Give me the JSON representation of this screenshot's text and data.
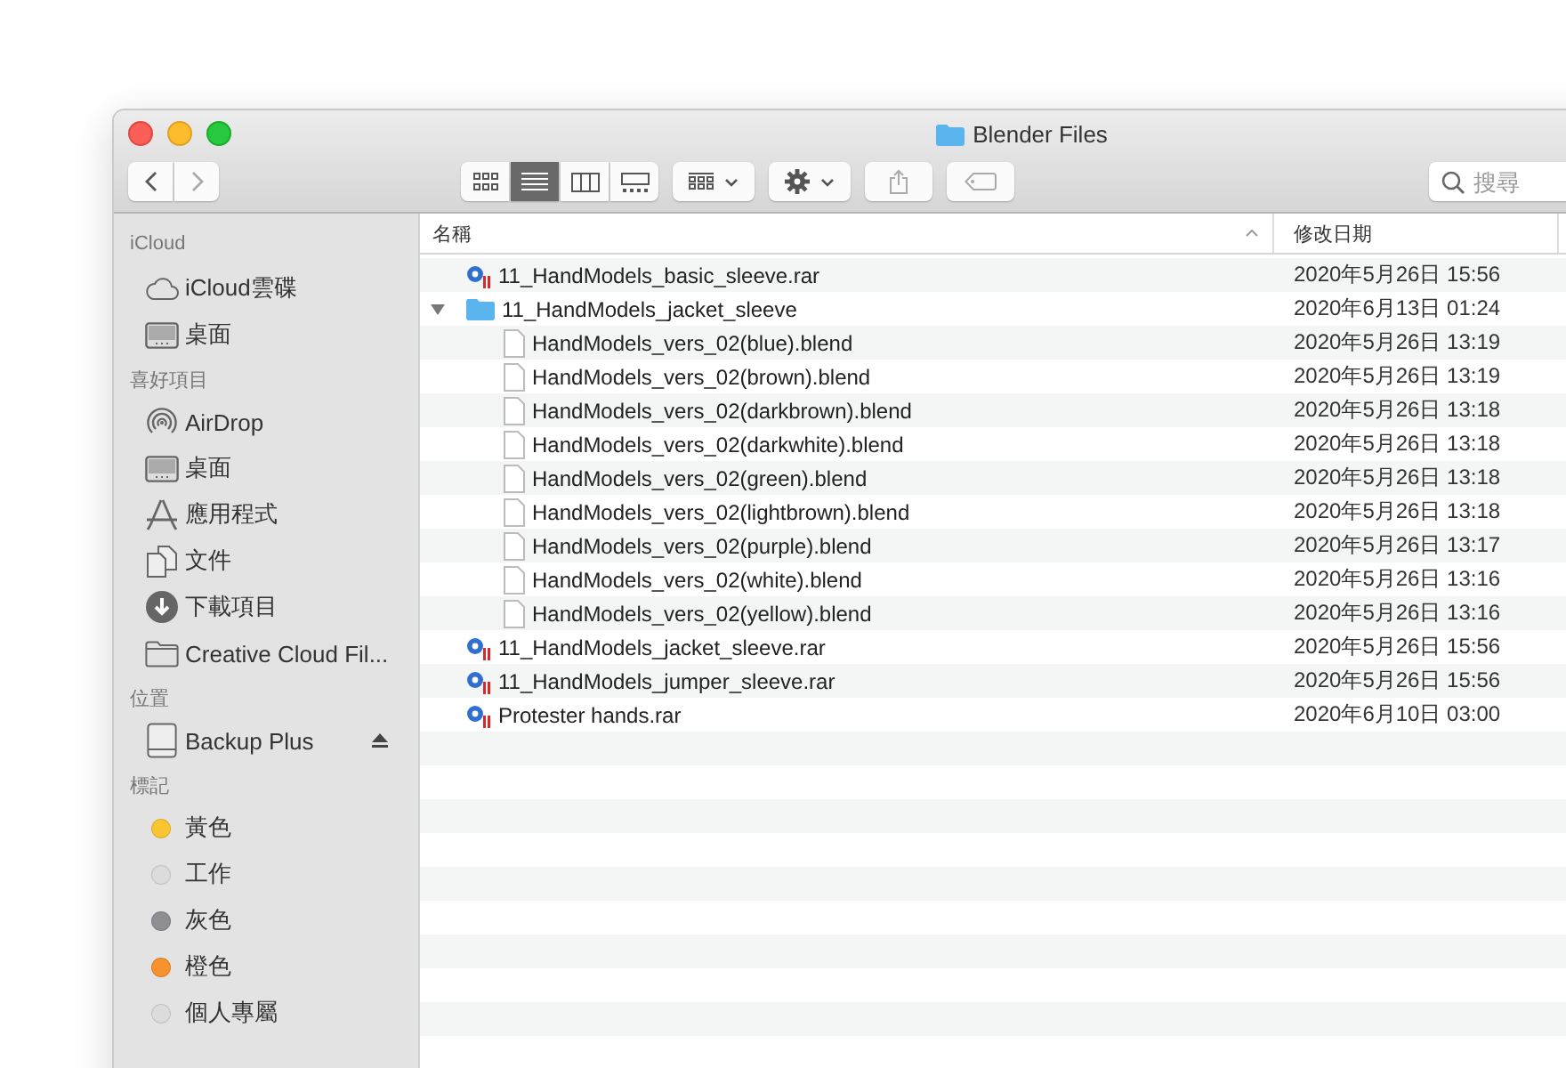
{
  "window": {
    "title": "Blender Files"
  },
  "toolbar": {
    "view_buttons": [
      {
        "kind": "icons",
        "selected": false
      },
      {
        "kind": "list",
        "selected": true
      },
      {
        "kind": "columns",
        "selected": false
      },
      {
        "kind": "gallery",
        "selected": false
      }
    ],
    "search": {
      "placeholder": "搜尋"
    }
  },
  "sidebar": {
    "sections": [
      {
        "title": "iCloud",
        "items": [
          {
            "kind": "cloud",
            "label": "iCloud雲碟"
          },
          {
            "kind": "desktop",
            "label": "桌面"
          }
        ]
      },
      {
        "title": "喜好項目",
        "items": [
          {
            "kind": "airdrop",
            "label": "AirDrop"
          },
          {
            "kind": "desktop",
            "label": "桌面"
          },
          {
            "kind": "apps",
            "label": "應用程式"
          },
          {
            "kind": "documents",
            "label": "文件"
          },
          {
            "kind": "downloads",
            "label": "下載項目"
          },
          {
            "kind": "folder",
            "label": "Creative Cloud Fil..."
          }
        ]
      },
      {
        "title": "位置",
        "items": [
          {
            "kind": "drive",
            "label": "Backup Plus"
          }
        ]
      },
      {
        "title": "標記",
        "items": [
          {
            "kind": "tag",
            "label": "黃色",
            "color": "#f9c531"
          },
          {
            "kind": "tag",
            "label": "工作",
            "color": "#dcdcdc"
          },
          {
            "kind": "tag",
            "label": "灰色",
            "color": "#8e8e93"
          },
          {
            "kind": "tag",
            "label": "橙色",
            "color": "#f7922e"
          },
          {
            "kind": "tag",
            "label": "個人專屬",
            "color": "#dcdcdc"
          }
        ]
      }
    ]
  },
  "table": {
    "columns": [
      "名稱",
      "修改日期"
    ],
    "rows": [
      {
        "kind": "archive",
        "name": "11_HandModels_basic_sleeve.rar",
        "date": "2020年5月26日 15:56"
      },
      {
        "kind": "folder",
        "name": "11_HandModels_jacket_sleeve",
        "date": "2020年6月13日 01:24",
        "expanded": true,
        "children": [
          {
            "kind": "document",
            "name": "HandModels_vers_02(blue).blend",
            "date": "2020年5月26日 13:19"
          },
          {
            "kind": "document",
            "name": "HandModels_vers_02(brown).blend",
            "date": "2020年5月26日 13:19"
          },
          {
            "kind": "document",
            "name": "HandModels_vers_02(darkbrown).blend",
            "date": "2020年5月26日 13:18"
          },
          {
            "kind": "document",
            "name": "HandModels_vers_02(darkwhite).blend",
            "date": "2020年5月26日 13:18"
          },
          {
            "kind": "document",
            "name": "HandModels_vers_02(green).blend",
            "date": "2020年5月26日 13:18"
          },
          {
            "kind": "document",
            "name": "HandModels_vers_02(lightbrown).blend",
            "date": "2020年5月26日 13:18"
          },
          {
            "kind": "document",
            "name": "HandModels_vers_02(purple).blend",
            "date": "2020年5月26日 13:17"
          },
          {
            "kind": "document",
            "name": "HandModels_vers_02(white).blend",
            "date": "2020年5月26日 13:16"
          },
          {
            "kind": "document",
            "name": "HandModels_vers_02(yellow).blend",
            "date": "2020年5月26日 13:16"
          }
        ]
      },
      {
        "kind": "archive",
        "name": "11_HandModels_jacket_sleeve.rar",
        "date": "2020年5月26日 15:56"
      },
      {
        "kind": "archive",
        "name": "11_HandModels_jumper_sleeve.rar",
        "date": "2020年5月26日 15:56"
      },
      {
        "kind": "archive",
        "name": "Protester hands.rar",
        "date": "2020年6月10日 03:00"
      }
    ]
  }
}
